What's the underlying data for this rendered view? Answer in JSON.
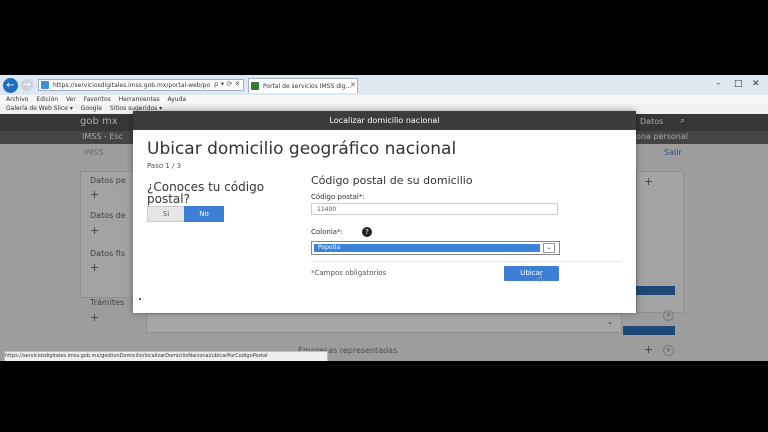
{
  "browser": {
    "address": "https://serviciosdigitales.imss.gob.mx/portal-web/po",
    "address_tools": "ρ ▾ ⟳ ✕",
    "tab_label": "Portal de servicios IMSS dig...",
    "menu": [
      "Archivo",
      "Edición",
      "Ver",
      "Favoritos",
      "Herramientas",
      "Ayuda"
    ],
    "favorites": [
      "Galería de Web Slice ▾",
      "Google",
      "Sitios sugeridos ▾"
    ],
    "status_url": "https://serviciosdigitales.imss.gob.mx/gestionDomicilio/localizarDomicilioNacional/ubicarPorCodigoPostal"
  },
  "page": {
    "gob_logo": "gob mx",
    "datos": "Datos",
    "imss_title": "IMSS - Esc",
    "persona": "ona personal",
    "side_text": "IMSS",
    "salir": "Salir",
    "side_labels": [
      "Datos pe",
      "Datos de",
      "Datos fis",
      "Trámites"
    ],
    "empresas": "Empresas representadas"
  },
  "modal": {
    "header": "Localizar domicilio nacional",
    "title": "Ubicar domicilio geográfico nacional",
    "paso": "Paso 1 / 3",
    "question": "¿Conoces tu código postal?",
    "si": "Si",
    "no": "No",
    "section_title": "Código postal de su domicilio",
    "cp_label": "Código postal*:",
    "cp_value": "11400",
    "colonia_label": "Colonia*:",
    "colonia_value": "Popotla",
    "required_note": "*Campos obligatorios",
    "ubicar": "Ubicar"
  },
  "colors": {
    "primary_blue": "#3d7fd4",
    "modal_header": "#3c3c3c",
    "gob_header": "#545454"
  }
}
